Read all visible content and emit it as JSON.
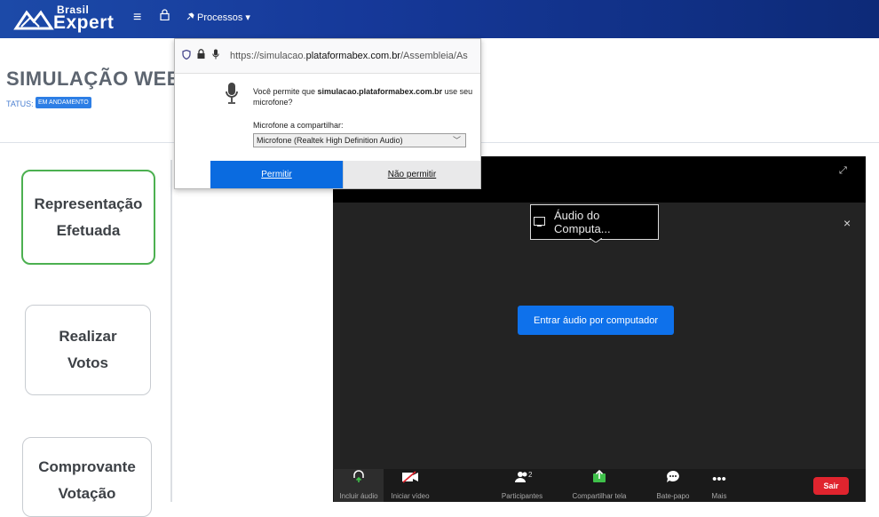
{
  "navbar": {
    "logo_top": "Brasil",
    "logo_bottom": "Expert",
    "menu_icon": "menu-icon",
    "lock_icon": "lock-icon",
    "processos_label": "Processos ▾"
  },
  "page": {
    "title": "SIMULAÇÃO WEB - EM",
    "status_label": "TATUS:",
    "status_badge": "EM ANDAMENTO"
  },
  "cards": [
    {
      "label": "Representação\nEfetuada",
      "active": true
    },
    {
      "label": "Realizar\nVotos",
      "active": false
    },
    {
      "label": "Comprovante\nVotação",
      "active": false
    }
  ],
  "popup": {
    "url_prefix": "https://simulacao.",
    "url_domain": "plataformabex.com.br",
    "url_suffix": "/Assembleia/As",
    "question_pre": "Você permite que ",
    "question_domain": "simulacao.plataformabex.com.br",
    "question_post": " use seu microfone?",
    "share_label": "Microfone a compartilhar:",
    "share_value": "Microfone (Realtek High Definition Audio)",
    "allow_label": "Permitir",
    "deny_label": "Não permitir"
  },
  "zoom": {
    "audio_pill": "Áudio do Computa...",
    "close_glyph": "×",
    "expand_glyph": "⤢",
    "join_audio": "Entrar áudio por computador",
    "toolbar": {
      "audio": "Incluir áudio",
      "video": "Iniciar vídeo",
      "participants": "Participantes",
      "participant_count": "2",
      "share": "Compartilhar tela",
      "chat": "Bate-papo",
      "more": "Mais",
      "leave": "Sair"
    }
  },
  "colors": {
    "navbar": "#16399a",
    "badge": "#2d7ee5",
    "active_card": "#4cb050",
    "zoom_blue": "#0e71eb",
    "leave_red": "#e0242e"
  }
}
